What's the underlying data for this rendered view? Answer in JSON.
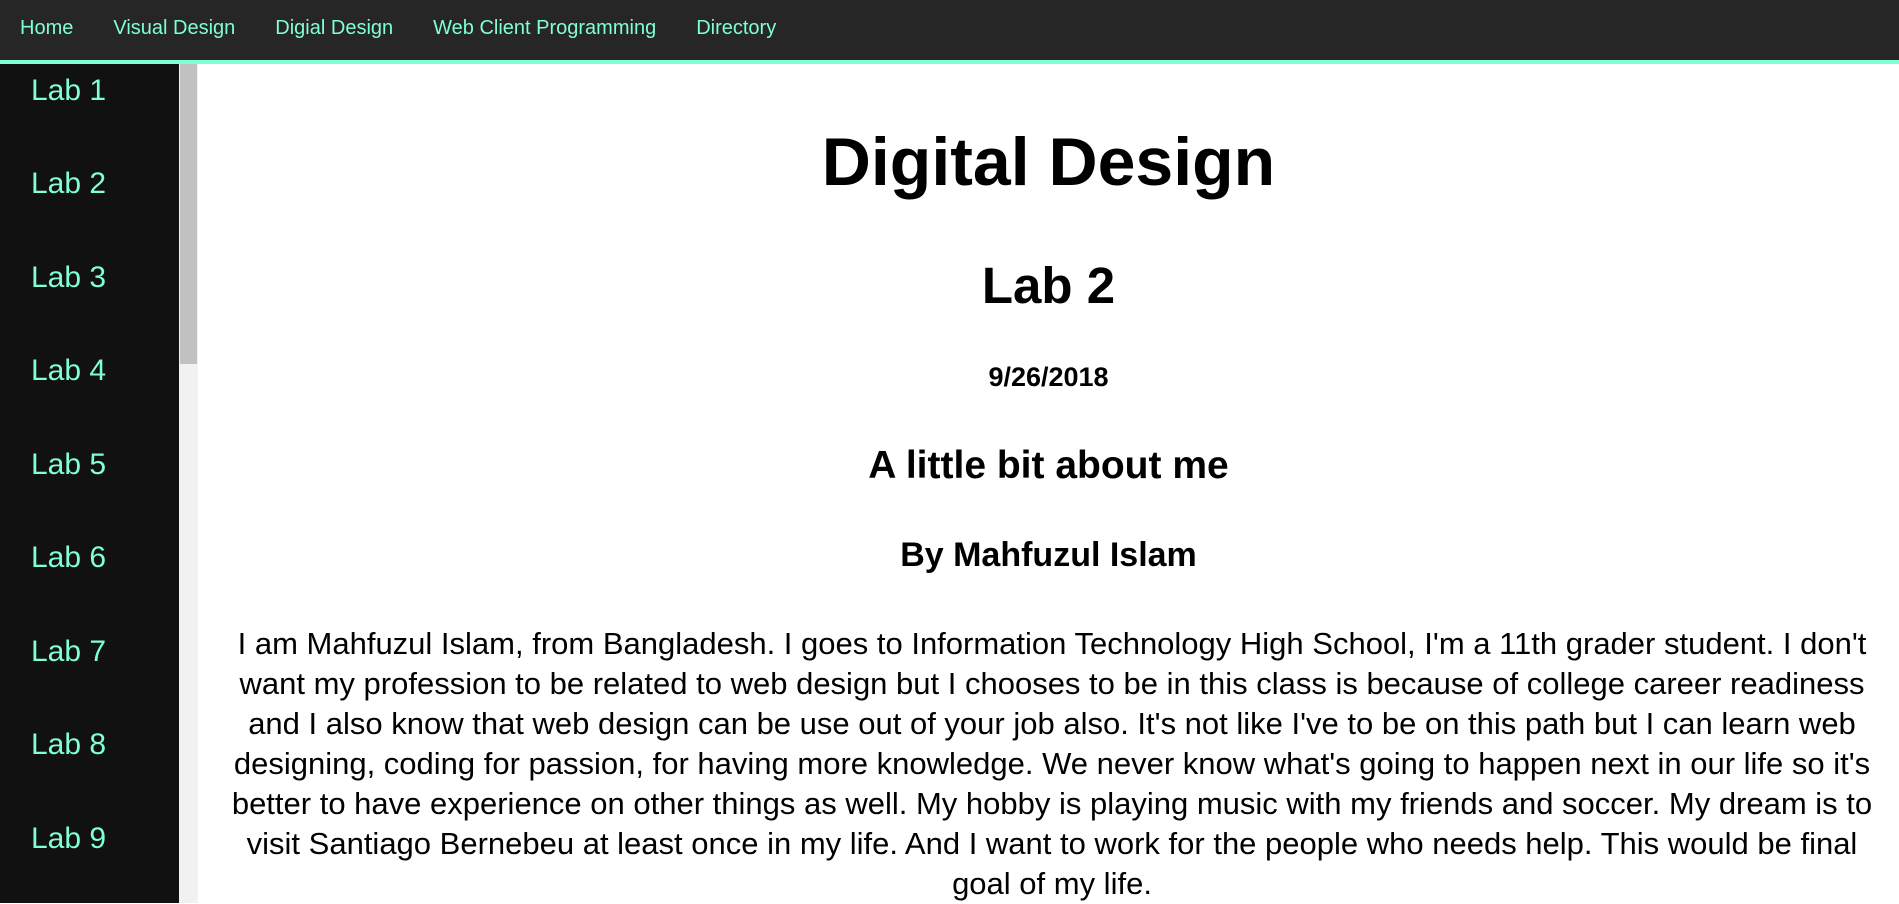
{
  "topnav": {
    "items": [
      {
        "label": "Home"
      },
      {
        "label": "Visual Design"
      },
      {
        "label": "Digial Design"
      },
      {
        "label": "Web Client Programming"
      },
      {
        "label": "Directory"
      }
    ]
  },
  "sidebar": {
    "items": [
      {
        "label": "Lab 1"
      },
      {
        "label": "Lab 2"
      },
      {
        "label": "Lab 3"
      },
      {
        "label": "Lab 4"
      },
      {
        "label": "Lab 5"
      },
      {
        "label": "Lab 6"
      },
      {
        "label": "Lab 7"
      },
      {
        "label": "Lab 8"
      },
      {
        "label": "Lab 9"
      }
    ]
  },
  "main": {
    "title": "Digital Design",
    "subtitle": "Lab 2",
    "date": "9/26/2018",
    "heading": "A little bit about me",
    "byline": "By Mahfuzul Islam",
    "paragraph": "I am Mahfuzul Islam, from Bangladesh. I goes to Information Technology High School, I'm a 11th grader student. I don't want my profession to be related to web design but I chooses to be in this class is because of college career readiness and I also know that web design can be use out of your job also. It's not like I've to be on this path but I can learn web designing, coding for passion, for having more knowledge. We never know what's going to happen next in our life so it's better to have experience on other things as well. My hobby is playing music with my friends and soccer. My dream is to visit Santiago Bernebeu at least once in my life. And I want to work for the people who needs help. This would be final goal of my life."
  },
  "colors": {
    "accent": "#7fffd4",
    "topnav_bg": "#262626",
    "sidebar_bg": "#111111"
  }
}
